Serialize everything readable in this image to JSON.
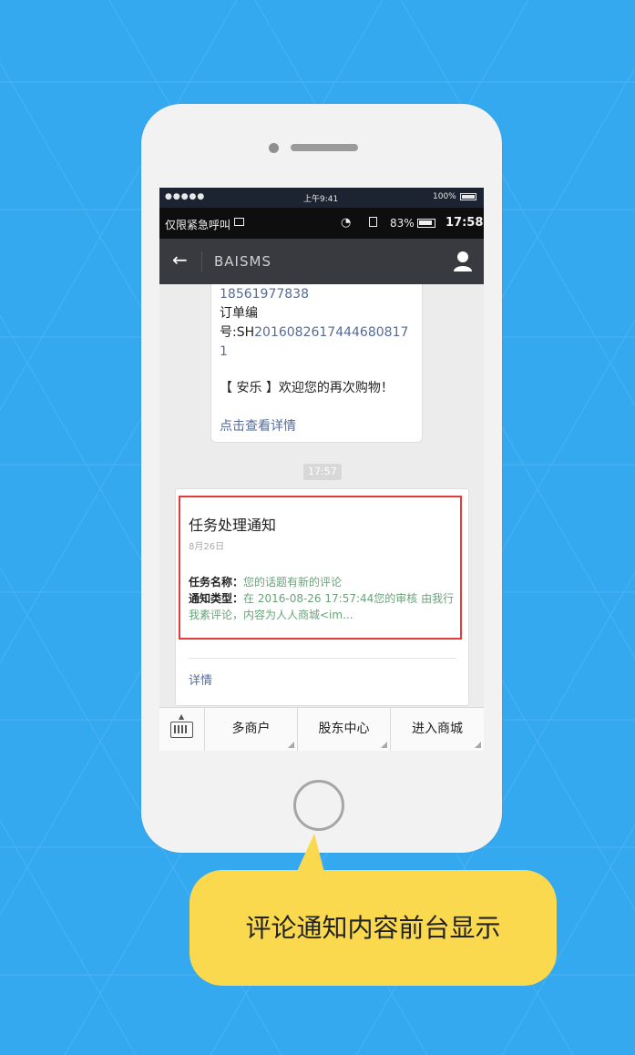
{
  "ios_status": {
    "carrier": "●●●●● ",
    "time": "上午9:41",
    "battery": "100%"
  },
  "android_status": {
    "left_text": "仅限紧急呼叫",
    "battery": "83%",
    "time": "17:58"
  },
  "nav": {
    "title": "BAISMS",
    "back_icon": "arrow-left-icon",
    "profile_icon": "user-icon"
  },
  "message1": {
    "phone": "18561977838",
    "order_label": "订单编",
    "order_prefix": "号:SH",
    "order_number": "20160826174446808171",
    "welcome": "【 安乐 】欢迎您的再次购物！",
    "detail_link": "点击查看详情"
  },
  "timestamp": "17:57",
  "card": {
    "title": "任务处理通知",
    "date": "8月26日",
    "task_name_label": "任务名称：",
    "task_name_value": "您的话题有新的评论",
    "notify_type_label": "通知类型：",
    "notify_type_value": "在 2016-08-26 17:57:44您的审核 由我行我素评论，内容为人人商城<im...",
    "detail": "详情",
    "highlight_color": "#e33b3b"
  },
  "menu": {
    "items": [
      "多商户",
      "股东中心",
      "进入商城"
    ],
    "keyboard_icon": "keyboard-icon"
  },
  "callout": {
    "text": "评论通知内容前台显示",
    "color": "#fad94f"
  },
  "colors": {
    "background": "#35a9f0",
    "nav": "#393a3f",
    "link": "#576b95",
    "value_green": "#6aa37a"
  }
}
